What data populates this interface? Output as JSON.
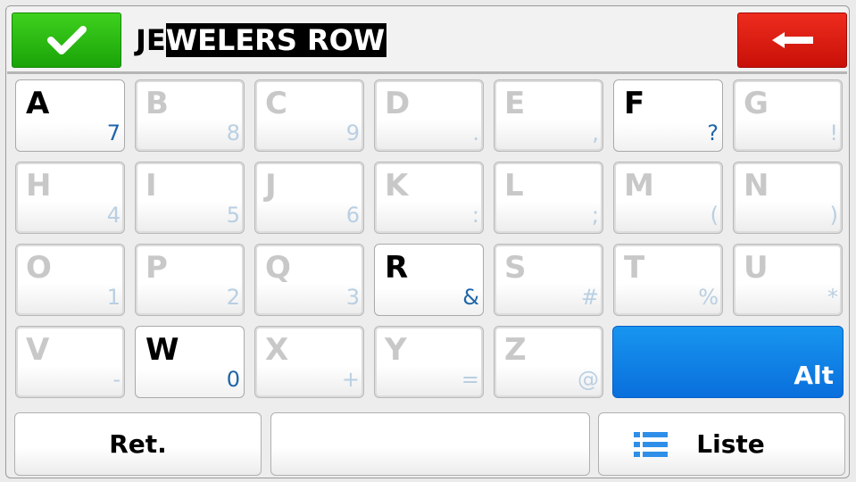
{
  "input": {
    "prefix": "JE",
    "selected": "WELERS ROW"
  },
  "top_actions": {
    "ok": "check-icon",
    "back": "back-arrow-icon"
  },
  "keys": [
    {
      "main": "A",
      "alt": "7",
      "enabled": true
    },
    {
      "main": "B",
      "alt": "8",
      "enabled": false
    },
    {
      "main": "C",
      "alt": "9",
      "enabled": false
    },
    {
      "main": "D",
      "alt": ".",
      "enabled": false
    },
    {
      "main": "E",
      "alt": ",",
      "enabled": false
    },
    {
      "main": "F",
      "alt": "?",
      "enabled": true
    },
    {
      "main": "G",
      "alt": "!",
      "enabled": false
    },
    {
      "main": "H",
      "alt": "4",
      "enabled": false
    },
    {
      "main": "I",
      "alt": "5",
      "enabled": false
    },
    {
      "main": "J",
      "alt": "6",
      "enabled": false
    },
    {
      "main": "K",
      "alt": ":",
      "enabled": false
    },
    {
      "main": "L",
      "alt": ";",
      "enabled": false
    },
    {
      "main": "M",
      "alt": "(",
      "enabled": false
    },
    {
      "main": "N",
      "alt": ")",
      "enabled": false
    },
    {
      "main": "O",
      "alt": "1",
      "enabled": false
    },
    {
      "main": "P",
      "alt": "2",
      "enabled": false
    },
    {
      "main": "Q",
      "alt": "3",
      "enabled": false
    },
    {
      "main": "R",
      "alt": "&",
      "enabled": true
    },
    {
      "main": "S",
      "alt": "#",
      "enabled": false
    },
    {
      "main": "T",
      "alt": "%",
      "enabled": false
    },
    {
      "main": "U",
      "alt": "*",
      "enabled": false
    },
    {
      "main": "V",
      "alt": "-",
      "enabled": false
    },
    {
      "main": "W",
      "alt": "0",
      "enabled": true
    },
    {
      "main": "X",
      "alt": "+",
      "enabled": false
    },
    {
      "main": "Y",
      "alt": "=",
      "enabled": false
    },
    {
      "main": "Z",
      "alt": "@",
      "enabled": false
    }
  ],
  "alt_key": {
    "label": "Alt"
  },
  "bottom": {
    "ret": "Ret.",
    "space": "",
    "list": "Liste",
    "list_icon": "list-icon"
  },
  "colors": {
    "ok": "#2bbd14",
    "back": "#dc1e12",
    "alt": "#0f82e6",
    "list_icon": "#2f8fe8"
  }
}
